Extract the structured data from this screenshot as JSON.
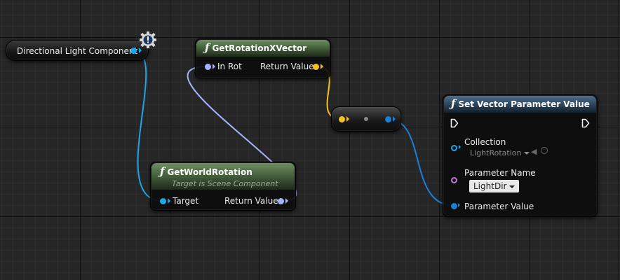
{
  "colors": {
    "object_pin": "#1ea6e6",
    "rotator_pin": "#aab2ff",
    "vector_pin": "#f5c11e",
    "linear_color_pin": "#1a7fd6",
    "name_pin": "#c07ad9",
    "pure_function_header": "#3e5737",
    "impure_function_header": "#2a4157"
  },
  "nodes": {
    "directional_light": {
      "label": "Directional Light Component",
      "warning_icon": "warning-gear-icon"
    },
    "get_rotation_x_vector": {
      "icon": "ƒ",
      "title": "GetRotationXVector",
      "input_label": "In Rot",
      "output_label": "Return Value"
    },
    "get_world_rotation": {
      "icon": "ƒ",
      "title": "GetWorldRotation",
      "subtitle": "Target is Scene Component",
      "input_label": "Target",
      "output_label": "Return Value"
    },
    "conversion": {
      "icon": "conversion-dot-icon"
    },
    "set_vector_parameter_value": {
      "icon": "ƒ",
      "title": "Set Vector Parameter Value",
      "collection_label": "Collection",
      "collection_value": "LightRotation",
      "parameter_name_label": "Parameter Name",
      "parameter_name_value": "LightDir",
      "parameter_value_label": "Parameter Value"
    }
  }
}
